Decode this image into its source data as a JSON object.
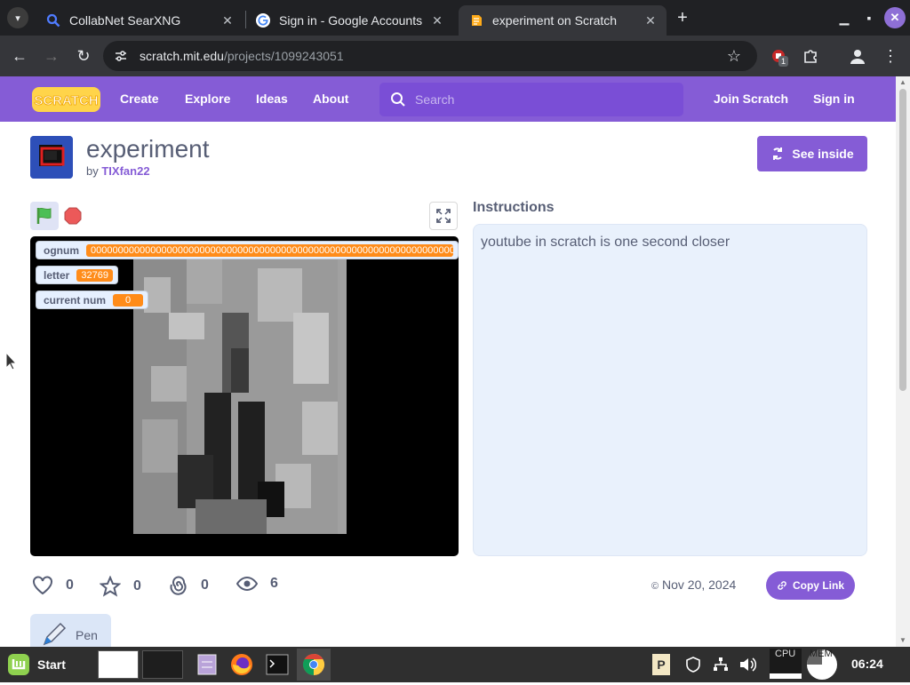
{
  "browser": {
    "tabs": [
      {
        "title": "CollabNet SearXNG",
        "icon": "search-favicon",
        "active": false
      },
      {
        "title": "Sign in - Google Accounts",
        "icon": "google-favicon",
        "active": false
      },
      {
        "title": "experiment on Scratch",
        "icon": "scratch-favicon",
        "active": true
      }
    ],
    "url_host": "scratch.mit.edu",
    "url_path": "/projects/1099243051",
    "extension_badge": "1"
  },
  "scratch_nav": {
    "logo_text": "SCRATCH",
    "links": [
      "Create",
      "Explore",
      "Ideas",
      "About"
    ],
    "search_placeholder": "Search",
    "join": "Join Scratch",
    "signin": "Sign in"
  },
  "project": {
    "title": "experiment",
    "by": "by",
    "author": "TIXfan22",
    "see_inside": "See inside",
    "instructions_heading": "Instructions",
    "instructions_text": "youtube in scratch is one second closer",
    "date": "Nov 20, 2024",
    "copy_link": "Copy Link",
    "stats": {
      "loves": "0",
      "favorites": "0",
      "remixes": "0",
      "views": "6"
    }
  },
  "stage_monitors": [
    {
      "name": "ognum",
      "value": "000000000000000000000000000000000000000000000000000000000000000000000000"
    },
    {
      "name": "letter",
      "value": "32769"
    },
    {
      "name": "current num",
      "value": "0"
    }
  ],
  "extensions": [
    {
      "name": "Pen"
    }
  ],
  "taskbar": {
    "start": "Start",
    "cpu_label": "CPU",
    "mem_label": "MEM",
    "clock": "06:24"
  },
  "colors": {
    "scratch_purple": "#855cd6",
    "monitor_orange": "#ff8c1a",
    "chrome_dark": "#202124"
  }
}
